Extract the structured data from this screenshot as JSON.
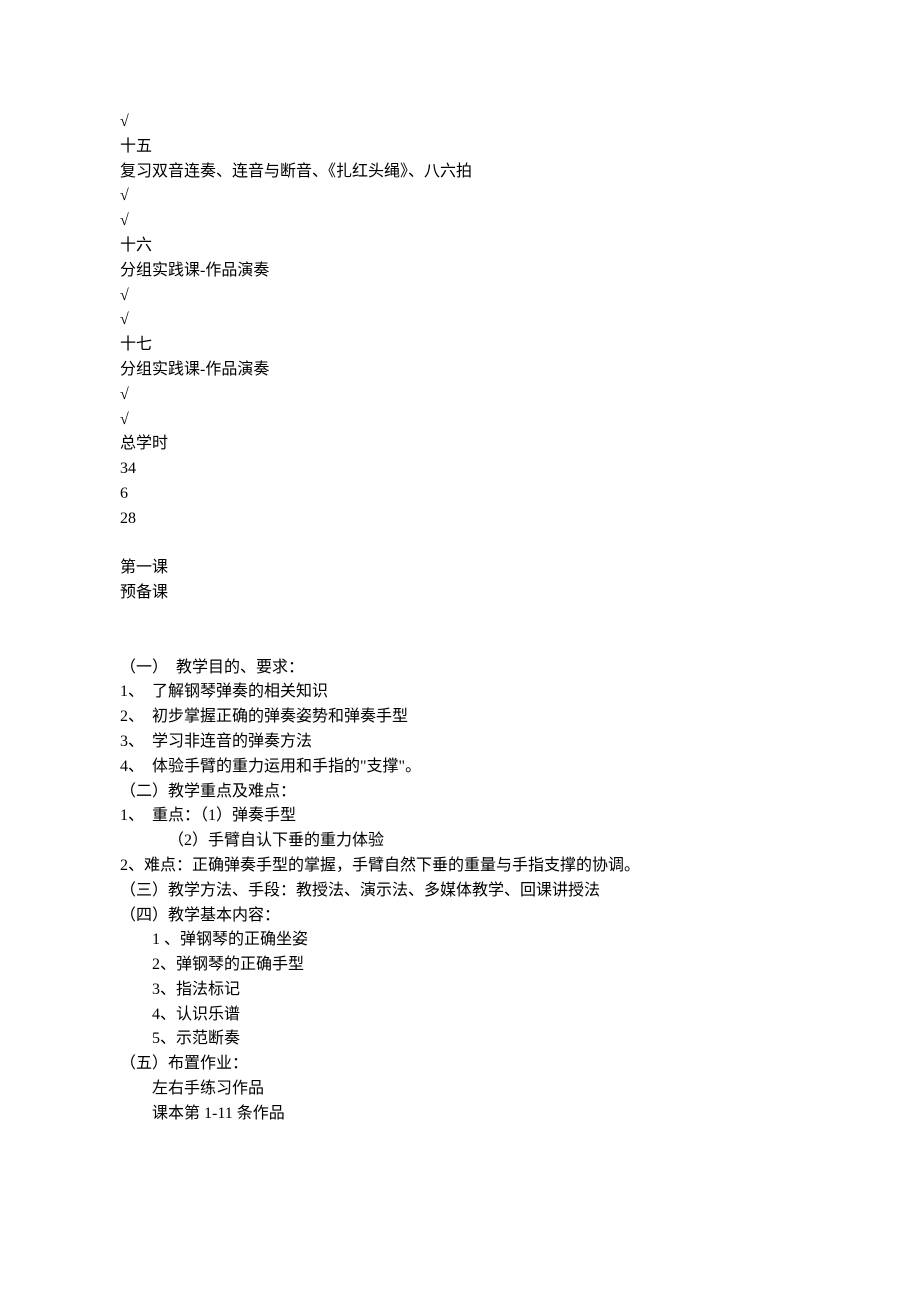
{
  "top_block": [
    "√",
    "十五",
    "复习双音连奏、连音与断音、《扎红头绳》、八六拍",
    "√",
    "√",
    "十六",
    "分组实践课-作品演奏",
    "√",
    "√",
    "十七",
    "分组实践课-作品演奏",
    "√",
    "√",
    "总学时",
    "34",
    "6",
    "28"
  ],
  "lesson_header": [
    "第一课",
    "预备课"
  ],
  "section1_title": "（一）  教学目的、要求：",
  "section1_items": [
    "1、  了解钢琴弹奏的相关知识",
    "2、  初步掌握正确的弹奏姿势和弹奏手型",
    "3、  学习非连音的弹奏方法",
    "4、  体验手臂的重力运用和手指的\"支撑\"。"
  ],
  "section2_title": "（二）教学重点及难点：",
  "section2_item1": "1、  重点：（1）弹奏手型",
  "section2_item1b": "（2）手臂自认下垂的重力体验",
  "section2_item2": "2、难点：正确弹奏手型的掌握，手臂自然下垂的重量与手指支撑的协调。",
  "section3": "（三）教学方法、手段：教授法、演示法、多媒体教学、回课讲授法",
  "section4_title": "（四）教学基本内容：",
  "section4_items": [
    "1 、弹钢琴的正确坐姿",
    "2、弹钢琴的正确手型",
    "3、指法标记",
    "4、认识乐谱",
    "5、示范断奏"
  ],
  "section5_title": "（五）布置作业：",
  "section5_items": [
    "左右手练习作品",
    "课本第 1-11 条作品"
  ]
}
